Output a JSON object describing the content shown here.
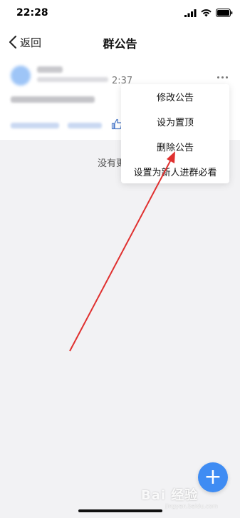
{
  "status_bar": {
    "time": "22:28"
  },
  "nav": {
    "back_label": "返回",
    "title": "群公告"
  },
  "post": {
    "time": "2:37"
  },
  "menu": {
    "items": [
      "修改公告",
      "设为置顶",
      "删除公告",
      "设置为新人进群必看"
    ]
  },
  "footer": {
    "no_more_text": "没有更"
  },
  "fab": {
    "label": "+"
  },
  "watermark": {
    "brand": "Bai 经验",
    "sub": "jingyan.baidu.com"
  },
  "colors": {
    "accent": "#3f8cf3",
    "annotation_arrow": "#e0302f"
  }
}
